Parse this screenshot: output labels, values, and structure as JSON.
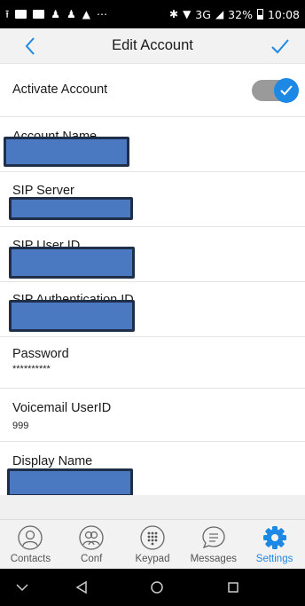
{
  "status_bar": {
    "network": "3G",
    "battery": "32%",
    "time": "10:08"
  },
  "header": {
    "title": "Edit Account"
  },
  "rows": {
    "activate": {
      "label": "Activate Account",
      "enabled": true
    },
    "account_name": {
      "label": "Account Name"
    },
    "sip_server": {
      "label": "SIP Server"
    },
    "sip_user_id": {
      "label": "SIP User ID"
    },
    "sip_auth_id": {
      "label": "SIP Authentication ID"
    },
    "password": {
      "label": "Password",
      "value": "**********"
    },
    "voicemail": {
      "label": "Voicemail UserID",
      "value": "999"
    },
    "display_name": {
      "label": "Display Name"
    }
  },
  "tabs": [
    {
      "label": "Contacts",
      "icon": "person-icon"
    },
    {
      "label": "Conf",
      "icon": "group-icon"
    },
    {
      "label": "Keypad",
      "icon": "keypad-icon"
    },
    {
      "label": "Messages",
      "icon": "chat-icon"
    },
    {
      "label": "Settings",
      "icon": "gear-icon",
      "active": true
    }
  ],
  "colors": {
    "accent": "#1e88e5",
    "redaction": "#4a79c2"
  }
}
